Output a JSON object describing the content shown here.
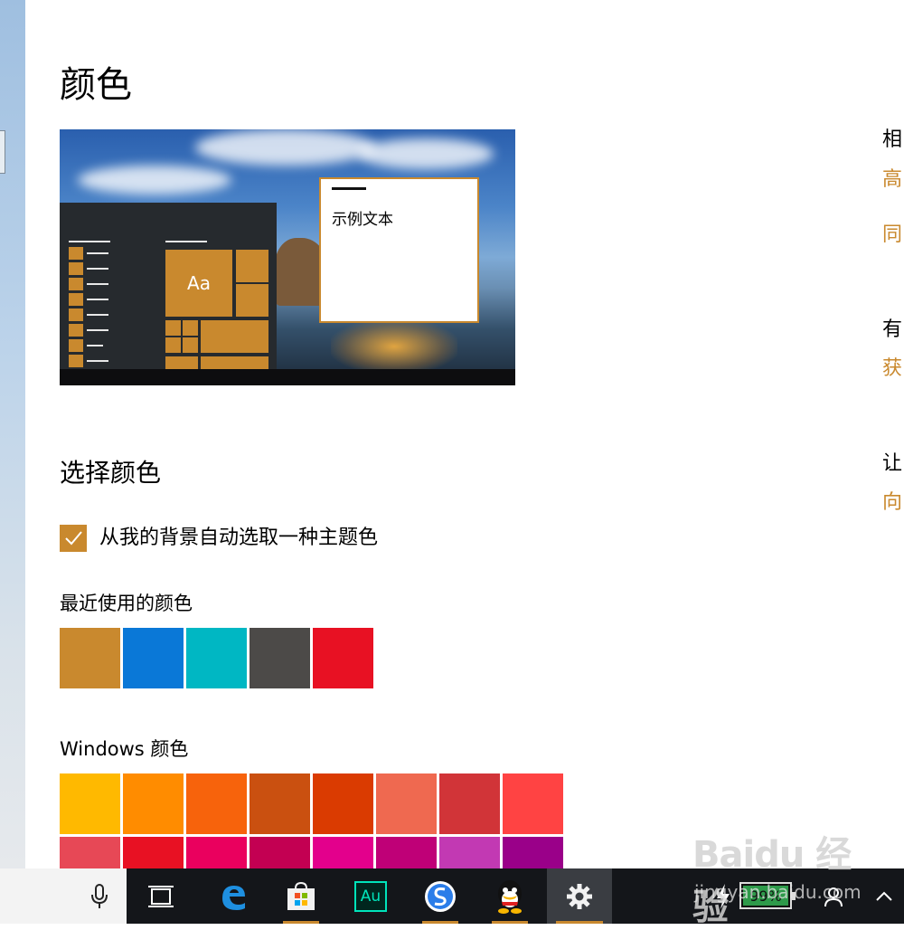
{
  "page": {
    "title": "颜色",
    "accent_color": "#c9892e"
  },
  "preview": {
    "sample_text": "示例文本",
    "tile_label": "Aa"
  },
  "choose_color": {
    "heading": "选择颜色",
    "auto_accent_label": "从我的背景自动选取一种主题色",
    "auto_accent_checked": true
  },
  "recent_colors": {
    "heading": "最近使用的颜色",
    "swatches": [
      "#c9892e",
      "#0a78d7",
      "#00b7c3",
      "#4c4a48",
      "#e81123"
    ]
  },
  "windows_colors": {
    "heading": "Windows 颜色",
    "row1": [
      "#ffb900",
      "#ff8c00",
      "#f7630c",
      "#ca5010",
      "#da3b01",
      "#ef6950",
      "#d13438",
      "#ff4343"
    ],
    "row2": [
      "#e74856",
      "#e81123",
      "#ea005e",
      "#c30052",
      "#e3008c",
      "#bf0077",
      "#c239b3",
      "#9a0089"
    ]
  },
  "right_column": [
    {
      "text": "相",
      "link": false
    },
    {
      "text": "高",
      "link": true
    },
    {
      "text": "同",
      "link": true
    },
    {
      "text": "有",
      "link": false
    },
    {
      "text": "获",
      "link": true
    },
    {
      "text": "让",
      "link": false
    },
    {
      "text": "向",
      "link": true
    }
  ],
  "taskbar": {
    "items": [
      "microphone-icon",
      "task-view-icon",
      "edge-icon",
      "store-icon",
      "audition-icon",
      "sogou-icon",
      "qq-icon",
      "settings-icon"
    ],
    "audition_label": "Au",
    "battery_percent_label": "99%"
  },
  "watermark": {
    "brand": "Baidu 经验",
    "url": "jingyan.baidu.com"
  }
}
